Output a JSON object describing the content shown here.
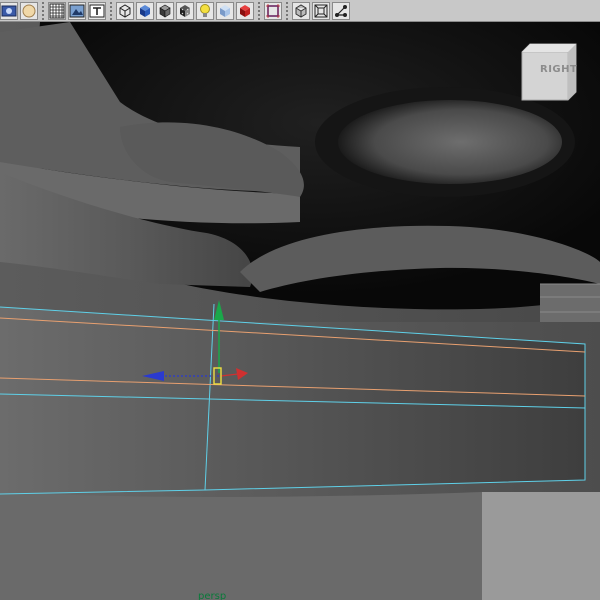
{
  "toolbar": {
    "buttons": [
      {
        "icon": "select-camera-icon"
      },
      {
        "icon": "image-plane-icon"
      },
      {
        "icon": "grid-icon"
      },
      {
        "icon": "resolution-gate-icon"
      },
      {
        "icon": "field-chart-icon"
      },
      {
        "icon": "wireframe-icon"
      },
      {
        "icon": "smooth-shade-icon"
      },
      {
        "icon": "shaded-wireframe-icon"
      },
      {
        "icon": "textured-icon"
      },
      {
        "icon": "use-all-lights-icon"
      },
      {
        "icon": "shadows-icon"
      },
      {
        "icon": "ambient-occlusion-icon"
      },
      {
        "icon": "isolate-select-icon"
      },
      {
        "icon": "xray-icon"
      },
      {
        "icon": "xray-joints-icon"
      },
      {
        "icon": "xray-components-icon"
      }
    ]
  },
  "viewport": {
    "view_cube": {
      "label": "RIGHT"
    },
    "camera_name": "persp",
    "colors": {
      "selection_wire": "#5fd0e8",
      "edge_loop": "#e8a070",
      "axis_y": "#1aa84a",
      "axis_x": "#d03030",
      "axis_z": "#2a3ad0",
      "camera_label": "#0a7a3a"
    }
  }
}
